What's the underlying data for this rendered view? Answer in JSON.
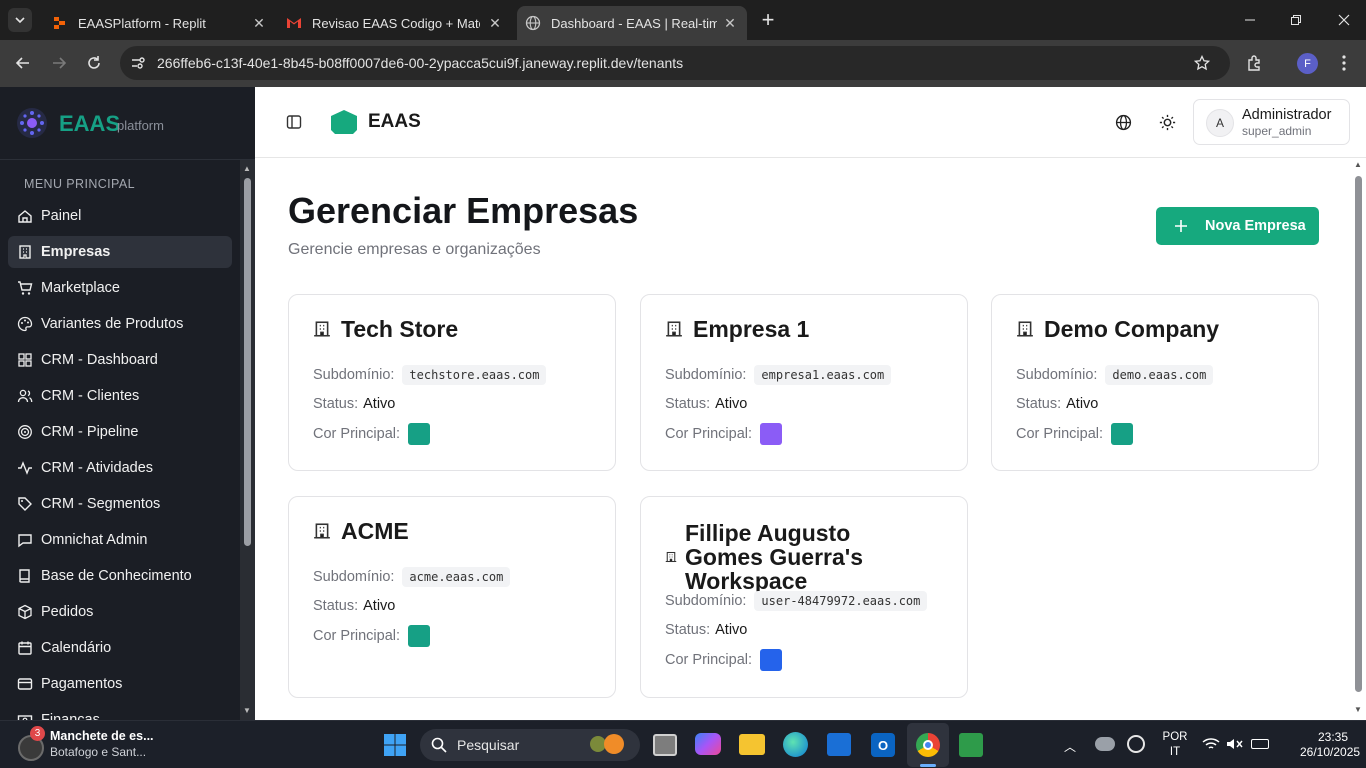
{
  "browser": {
    "tabs": [
      {
        "title": "EAASPlatform - Replit",
        "icon": "replit-icon"
      },
      {
        "title": "Revisao EAAS Codigo + Matem",
        "icon": "gmail-icon"
      },
      {
        "title": "Dashboard - EAAS | Real-time B",
        "icon": "globe-icon",
        "active": true
      }
    ],
    "url": "266ffeb6-c13f-40e1-8b45-b08ff0007de6-00-2ypacca5cui9f.janeway.replit.dev/tenants",
    "profile_initial": "F"
  },
  "sidebar": {
    "brand": "EAAS",
    "brand_sub": "platform",
    "section_title": "MENU PRINCIPAL",
    "items": [
      {
        "label": "Painel",
        "icon": "home-icon"
      },
      {
        "label": "Empresas",
        "icon": "building-icon",
        "active": true
      },
      {
        "label": "Marketplace",
        "icon": "cart-icon"
      },
      {
        "label": "Variantes de Produtos",
        "icon": "palette-icon"
      },
      {
        "label": "CRM - Dashboard",
        "icon": "grid-icon"
      },
      {
        "label": "CRM - Clientes",
        "icon": "users-icon"
      },
      {
        "label": "CRM - Pipeline",
        "icon": "target-icon"
      },
      {
        "label": "CRM - Atividades",
        "icon": "activity-icon"
      },
      {
        "label": "CRM - Segmentos",
        "icon": "tag-icon"
      },
      {
        "label": "Omnichat Admin",
        "icon": "chat-icon"
      },
      {
        "label": "Base de Conhecimento",
        "icon": "book-icon"
      },
      {
        "label": "Pedidos",
        "icon": "package-icon"
      },
      {
        "label": "Calendário",
        "icon": "calendar-icon"
      },
      {
        "label": "Pagamentos",
        "icon": "card-icon"
      },
      {
        "label": "Finanças",
        "icon": "money-icon"
      }
    ]
  },
  "header": {
    "app_name": "EAAS",
    "user_avatar": "A",
    "user_name": "Administrador",
    "user_role": "super_admin"
  },
  "page": {
    "title": "Gerenciar Empresas",
    "subtitle": "Gerencie empresas e organizações",
    "new_button": "Nova Empresa",
    "labels": {
      "subdomain": "Subdomínio:",
      "status": "Status:",
      "color": "Cor Principal:"
    },
    "companies": [
      {
        "name": "Tech Store",
        "subdomain": "techstore.eaas.com",
        "status": "Ativo",
        "color": "#16a085"
      },
      {
        "name": "Empresa 1",
        "subdomain": "empresa1.eaas.com",
        "status": "Ativo",
        "color": "#8b5cf6"
      },
      {
        "name": "Demo Company",
        "subdomain": "demo.eaas.com",
        "status": "Ativo",
        "color": "#16a085"
      },
      {
        "name": "ACME",
        "subdomain": "acme.eaas.com",
        "status": "Ativo",
        "color": "#16a085"
      },
      {
        "name": "Fillipe Augusto Gomes Guerra's Workspace",
        "subdomain": "user-48479972.eaas.com",
        "status": "Ativo",
        "color": "#2563eb"
      }
    ]
  },
  "taskbar": {
    "news_badge": "3",
    "news_title": "Manchete de es...",
    "news_sub": "Botafogo e Sant...",
    "search_placeholder": "Pesquisar",
    "lang_1": "POR",
    "lang_2": "IT",
    "time": "23:35",
    "date": "26/10/2025"
  },
  "colors": {
    "accent": "#16a085",
    "sidebar_bg": "#1b1e25",
    "chrome_bg": "#1f1f1f"
  }
}
